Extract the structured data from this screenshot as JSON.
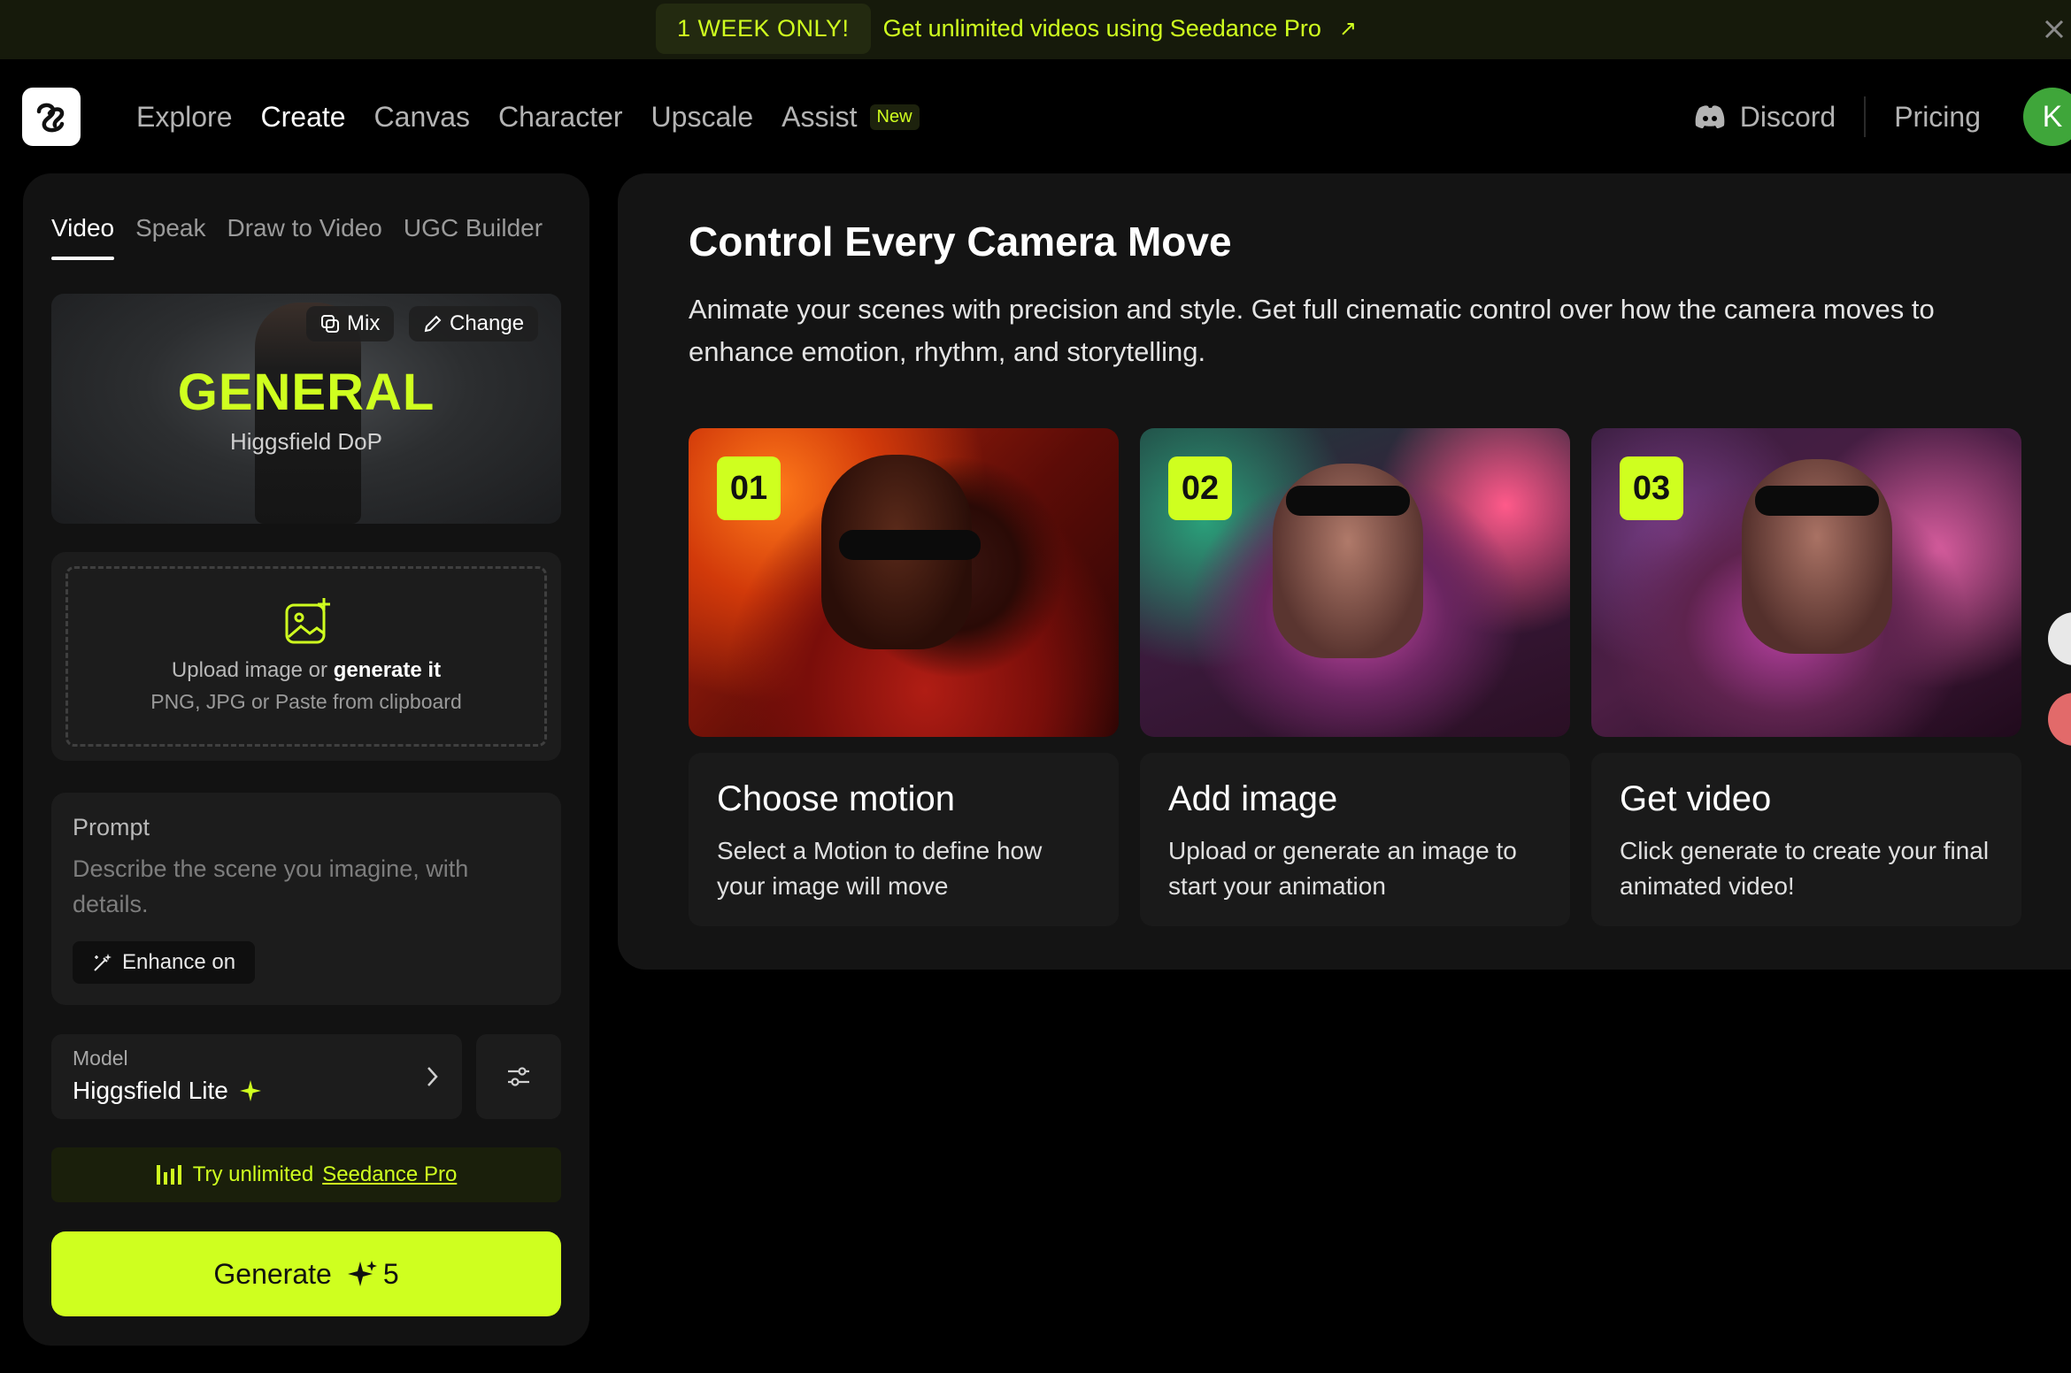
{
  "promo": {
    "badge": "1 WEEK ONLY!",
    "text": "Get unlimited videos using Seedance Pro",
    "arrow": "↗"
  },
  "nav": {
    "items": [
      "Explore",
      "Create",
      "Canvas",
      "Character",
      "Upscale",
      "Assist"
    ],
    "new_badge": "New",
    "discord": "Discord",
    "pricing": "Pricing",
    "avatar_initial": "K"
  },
  "left": {
    "tabs": [
      "Video",
      "Speak",
      "Draw to Video",
      "UGC Builder"
    ],
    "preset": {
      "mix_label": "Mix",
      "change_label": "Change",
      "title": "GENERAL",
      "subtitle": "Higgsfield DoP"
    },
    "upload": {
      "line1_prefix": "Upload image or",
      "line1_link": "generate it",
      "line2": "PNG, JPG or Paste from clipboard"
    },
    "prompt": {
      "label": "Prompt",
      "placeholder": "Describe the scene you imagine, with details.",
      "enhance": "Enhance on"
    },
    "model": {
      "label": "Model",
      "value": "Higgsfield Lite"
    },
    "try": {
      "prefix": "Try unlimited",
      "link": "Seedance Pro"
    },
    "generate": {
      "label": "Generate",
      "cost": "5"
    }
  },
  "main": {
    "title": "Control Every Camera Move",
    "description": "Animate your scenes with precision and style. Get full cinematic control over how the camera moves to enhance emotion, rhythm, and storytelling.",
    "steps": [
      {
        "num": "01",
        "title": "Choose motion",
        "desc": "Select a Motion to define how your image will move"
      },
      {
        "num": "02",
        "title": "Add image",
        "desc": "Upload or generate an image to start your animation"
      },
      {
        "num": "03",
        "title": "Get video",
        "desc": "Click generate to create your final animated video!"
      }
    ]
  },
  "colors": {
    "accent": "#cfff1f",
    "panel": "#121212",
    "card": "#1c1c1c",
    "avatar": "#3fa63a"
  }
}
